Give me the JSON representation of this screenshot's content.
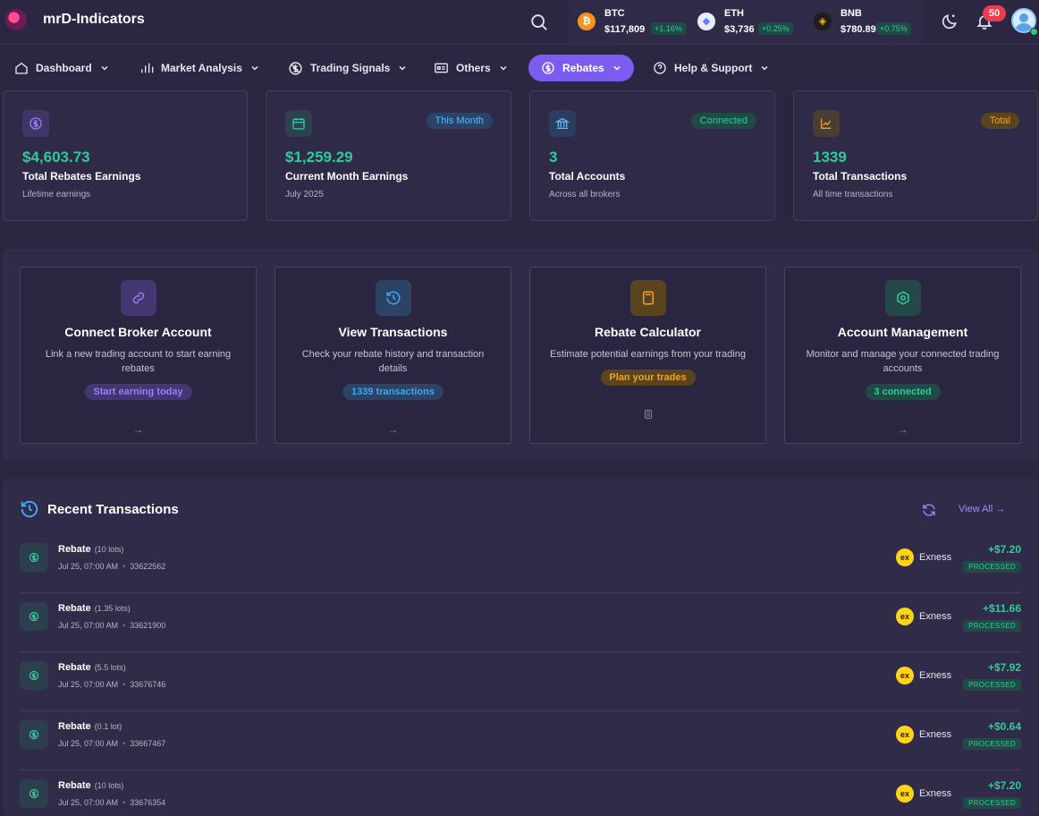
{
  "app": {
    "brand": "mrD-Indicators"
  },
  "tickers": [
    {
      "symbol": "BTC",
      "price": "$117,809",
      "change": "+1.16%",
      "icon": "bitcoin-icon",
      "color": "#f7931a"
    },
    {
      "symbol": "ETH",
      "price": "$3,736",
      "change": "+0.25%",
      "icon": "ethereum-icon",
      "color": "#e8ecff"
    },
    {
      "symbol": "BNB",
      "price": "$780.89",
      "change": "+0.75%",
      "icon": "bnb-icon",
      "color": "#f0b90b"
    }
  ],
  "notifications": {
    "count": "50"
  },
  "nav": {
    "items": [
      {
        "label": "Dashboard",
        "icon": "home-icon"
      },
      {
        "label": "Market Analysis",
        "icon": "bar-chart-icon"
      },
      {
        "label": "Trading Signals",
        "icon": "signal-icon"
      },
      {
        "label": "Others",
        "icon": "id-card-icon"
      },
      {
        "label": "Rebates",
        "icon": "dollar-circle-icon",
        "active": true
      },
      {
        "label": "Help & Support",
        "icon": "question-icon"
      }
    ]
  },
  "stats": [
    {
      "value": "$4,603.73",
      "label": "Total Rebates Earnings",
      "sub": "Lifetime earnings",
      "badge": "",
      "icon": "dollar-circle-icon"
    },
    {
      "value": "$1,259.29",
      "label": "Current Month Earnings",
      "sub": "July 2025",
      "badge": "This Month",
      "icon": "calendar-icon"
    },
    {
      "value": "3",
      "label": "Total Accounts",
      "sub": "Across all brokers",
      "badge": "Connected",
      "icon": "bank-icon"
    },
    {
      "value": "1339",
      "label": "Total Transactions",
      "sub": "All time transactions",
      "badge": "Total",
      "icon": "line-chart-icon"
    }
  ],
  "actions": [
    {
      "title": "Connect Broker Account",
      "desc": "Link a new trading account to start earning rebates",
      "pill": "Start earning today",
      "icon": "link-icon",
      "color": "#8b6cf5"
    },
    {
      "title": "View Transactions",
      "desc": "Check your rebate history and transaction details",
      "pill": "1339 transactions",
      "icon": "history-icon",
      "color": "#3ea6f0"
    },
    {
      "title": "Rebate Calculator",
      "desc": "Estimate potential earnings from your trading",
      "pill": "Plan your trades",
      "icon": "calculator-icon",
      "color": "#f0a31a"
    },
    {
      "title": "Account Management",
      "desc": "Monitor and manage your connected trading accounts",
      "pill": "3 connected",
      "icon": "settings-hex-icon",
      "color": "#2ecc9a"
    }
  ],
  "transactions": {
    "title": "Recent Transactions",
    "view_all": "View All",
    "rows": [
      {
        "type": "Rebate",
        "lots": "(10 lots)",
        "date": "Jul 25, 07:00 AM",
        "id": "33622562",
        "broker": "Exness",
        "amount": "+$7.20",
        "status": "PROCESSED"
      },
      {
        "type": "Rebate",
        "lots": "(1.35 lots)",
        "date": "Jul 25, 07:00 AM",
        "id": "33621900",
        "broker": "Exness",
        "amount": "+$11.66",
        "status": "PROCESSED"
      },
      {
        "type": "Rebate",
        "lots": "(5.5 lots)",
        "date": "Jul 25, 07:00 AM",
        "id": "33676746",
        "broker": "Exness",
        "amount": "+$7.92",
        "status": "PROCESSED"
      },
      {
        "type": "Rebate",
        "lots": "(0.1 lot)",
        "date": "Jul 25, 07:00 AM",
        "id": "33667467",
        "broker": "Exness",
        "amount": "+$0.64",
        "status": "PROCESSED"
      },
      {
        "type": "Rebate",
        "lots": "(10 lots)",
        "date": "Jul 25, 07:00 AM",
        "id": "33676354",
        "broker": "Exness",
        "amount": "+$7.20",
        "status": "PROCESSED"
      }
    ]
  },
  "broker_logo": "ex"
}
